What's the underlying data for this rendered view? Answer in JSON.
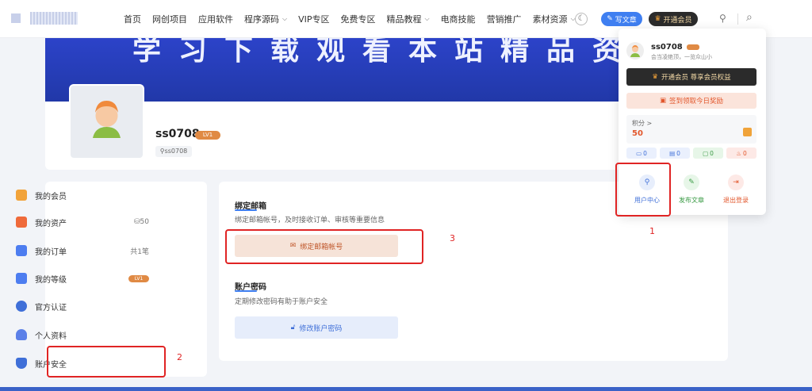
{
  "nav": {
    "items": [
      {
        "label": "首页",
        "dropdown": false
      },
      {
        "label": "网创项目",
        "dropdown": false
      },
      {
        "label": "应用软件",
        "dropdown": false
      },
      {
        "label": "程序源码",
        "dropdown": true
      },
      {
        "label": "VIP专区",
        "dropdown": false
      },
      {
        "label": "免费专区",
        "dropdown": false
      },
      {
        "label": "精品教程",
        "dropdown": true
      },
      {
        "label": "电商技能",
        "dropdown": false
      },
      {
        "label": "营销推广",
        "dropdown": false
      },
      {
        "label": "素材资源",
        "dropdown": true
      }
    ],
    "write_label": "写文章",
    "vip_label": "开通会员"
  },
  "banner": {
    "text": "学习下载观看本站精品资源"
  },
  "profile": {
    "username": "ss0708",
    "level": "LV1",
    "uid": "ss0708"
  },
  "sidebar": {
    "items": [
      {
        "label": "我的会员",
        "right": ""
      },
      {
        "label": "我的资产",
        "right": "50"
      },
      {
        "label": "我的订单",
        "right": "共1笔"
      },
      {
        "label": "我的等级",
        "right": "LV1"
      },
      {
        "label": "官方认证",
        "right": ""
      },
      {
        "label": "个人资料",
        "right": ""
      },
      {
        "label": "账户安全",
        "right": ""
      }
    ]
  },
  "main": {
    "email": {
      "title": "绑定邮箱",
      "desc": "绑定邮箱帐号，及时接收订单、审核等重要信息",
      "button": "绑定邮箱帐号"
    },
    "password": {
      "title": "账户密码",
      "desc": "定期修改密码有助于账户安全",
      "button": "修改账户密码"
    }
  },
  "dropdown": {
    "username": "ss0708",
    "motto": "会当凌绝顶，一览众山小",
    "vip_button": "开通会员 尊享会员权益",
    "checkin_button": "签到领取今日奖励",
    "points_label": "积分 >",
    "points_value": "50",
    "stats": [
      "0",
      "0",
      "0",
      "0"
    ],
    "actions": [
      "用户中心",
      "发布文章",
      "退出登录"
    ]
  },
  "annotations": [
    "1",
    "2",
    "3"
  ],
  "colors": {
    "primary": "#3f7ff1",
    "accent": "#e2572c",
    "annotation": "#e02424",
    "banner": "#2c43c9"
  }
}
